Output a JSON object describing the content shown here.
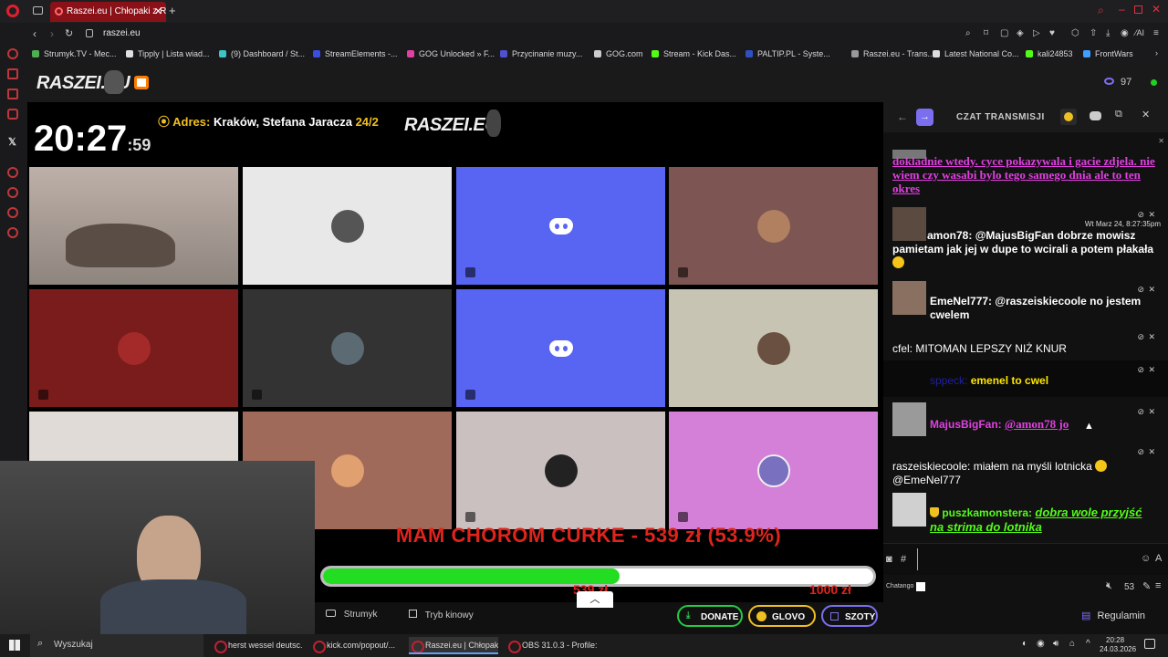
{
  "browser": {
    "active_tab_title": "Raszei.eu | Chłopaki z Ras",
    "url": "raszei.eu",
    "bookmarks": [
      {
        "label": "Strumyk.TV - Mec...",
        "color": "#4caf50"
      },
      {
        "label": "Tipply | Lista wiad...",
        "color": "#e0e0e0"
      },
      {
        "label": "(9) Dashboard / St...",
        "color": "#3ec4c4"
      },
      {
        "label": "StreamElements -...",
        "color": "#3c4ee0"
      },
      {
        "label": "GOG Unlocked » F...",
        "color": "#e040a0"
      },
      {
        "label": "Przycinanie muzy...",
        "color": "#5050d0"
      },
      {
        "label": "GOG.com",
        "color": "#cccccc"
      },
      {
        "label": "Stream - Kick Das...",
        "color": "#53fc18"
      },
      {
        "label": "PALTIP.PL - Syste...",
        "color": "#3050c0"
      },
      {
        "label": "Raszei.eu - Trans...",
        "color": "#999999"
      },
      {
        "label": "Latest National Co...",
        "color": "#dddddd"
      },
      {
        "label": "kali24853",
        "color": "#53fc18"
      },
      {
        "label": "FrontWars",
        "color": "#40a0ff"
      }
    ]
  },
  "site": {
    "logo": "RASZEI.EU",
    "viewers": "97"
  },
  "stream": {
    "clock_main": "20:27",
    "clock_seconds": ":59",
    "address_label": "Adres:",
    "address_value": "Kraków, Stefana Jaracza",
    "address_number": "24/2",
    "overlay_logo": "RASZEI.EU",
    "goal_text": "MAM CHOROM CURKE - 539 zł (53.9%)",
    "goal_progress": 0.539,
    "goal_current": "539 zł",
    "goal_target": "1000 zł",
    "colors": {
      "goal_text": "#e0241c",
      "progress": "#22dd22",
      "discord": "#5865f2"
    }
  },
  "chat": {
    "title": "CZAT TRANSMISJI",
    "messages": [
      {
        "text": "dokladnie wtedy. cyce pokazywala i gacie zdjela. nie wiem czy wasabi bylo tego samego dnia ale to ten okres"
      },
      {
        "timestamp": "Wt Marz 24, 8:27:35pm",
        "user": "amon78:",
        "text": "@MajusBigFan dobrze mowisz pamietam jak jej w dupe to wcirali a potem płakała"
      },
      {
        "user": "EmeNel777:",
        "text": "@raszeiskiecoole no jestem cwelem"
      },
      {
        "user": "cfel:",
        "text": "MITOMAN LEPSZY NIŻ KNUR"
      },
      {
        "user": "sppeck:",
        "text": "emenel to cwel"
      },
      {
        "user": "MajusBigFan:",
        "text": "@amon78 jo"
      },
      {
        "user": "raszeiskiecoole:",
        "text": "miałem na myśli lotnicka",
        "text2": "@EmeNel777"
      },
      {
        "user": "puszkamonstera:",
        "text": "dobra wole przyjść na strima do lotnika"
      }
    ],
    "input_prefix": "#",
    "footer_label": "Chatango",
    "volume_count": "53"
  },
  "bottom": {
    "strumyk": "Strumyk",
    "cinema": "Tryb kinowy",
    "donate": "DONATE",
    "glovo": "GLOVO",
    "szoty": "SZOTY",
    "regulamin": "Regulamin"
  },
  "taskbar": {
    "search_placeholder": "Wyszukaj",
    "items": [
      "herst wessel deutsc...",
      "kick.com/popout/...",
      "Raszei.eu | Chłopak...",
      "OBS 31.0.3 - Profile:..."
    ],
    "time": "20:28",
    "date": "24.03.2026"
  }
}
